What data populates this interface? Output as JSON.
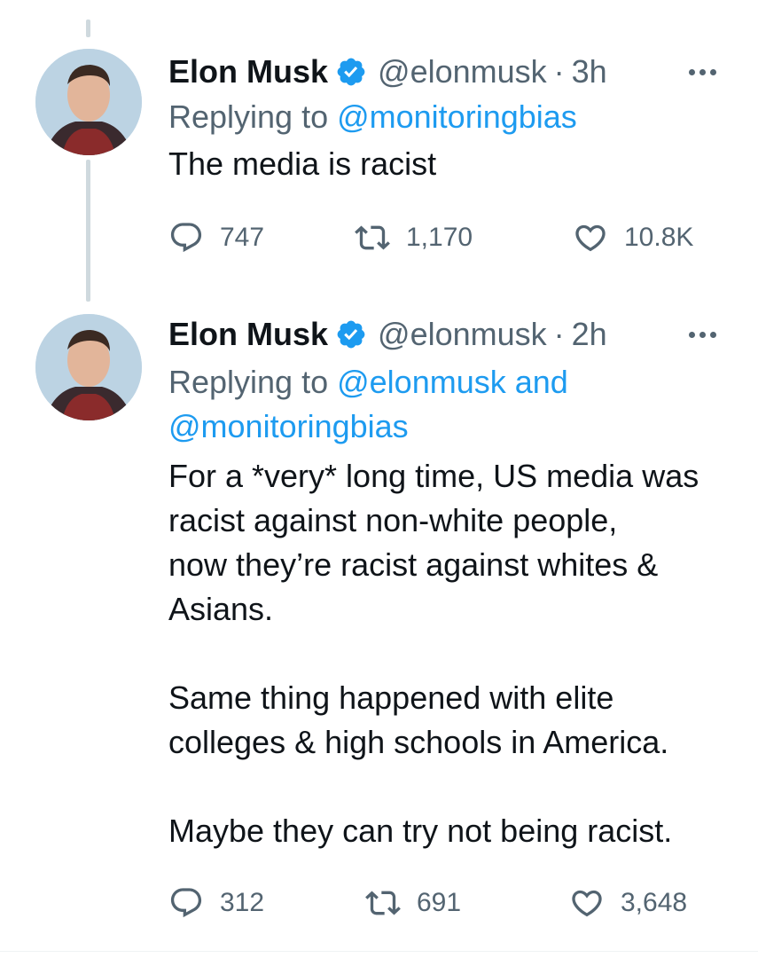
{
  "colors": {
    "text": "#0f1419",
    "secondary": "#536471",
    "link": "#1d9bf0",
    "verified": "#1d9bf0",
    "thread_line": "#cfd9de"
  },
  "tweets": [
    {
      "author": {
        "name": "Elon Musk",
        "handle": "@elonmusk",
        "verified_icon": "verified-badge-icon",
        "avatar": "avatar"
      },
      "time_separator": "·",
      "time": "3h",
      "more_icon": "more-dots-icon",
      "replying_prefix": "Replying to ",
      "replying_to": [
        "@monitoringbias"
      ],
      "text": "The media is racist",
      "stats": {
        "replies": "747",
        "retweets": "1,170",
        "likes": "10.8K"
      }
    },
    {
      "author": {
        "name": "Elon Musk",
        "handle": "@elonmusk",
        "verified_icon": "verified-badge-icon",
        "avatar": "avatar"
      },
      "time_separator": "·",
      "time": "2h",
      "more_icon": "more-dots-icon",
      "replying_prefix": "Replying to ",
      "replying_to_line1": "@elonmusk and",
      "replying_to_line2": "@monitoringbias",
      "text": "For a *very* long time, US media was\nracist against non-white people,\nnow they’re racist against whites &\nAsians.\n\nSame thing happened with elite\ncolleges & high schools in America.\n\nMaybe they can try not being racist.",
      "stats": {
        "replies": "312",
        "retweets": "691",
        "likes": "3,648"
      }
    }
  ],
  "icons": {
    "reply": "reply-icon",
    "retweet": "retweet-icon",
    "like": "heart-icon"
  }
}
